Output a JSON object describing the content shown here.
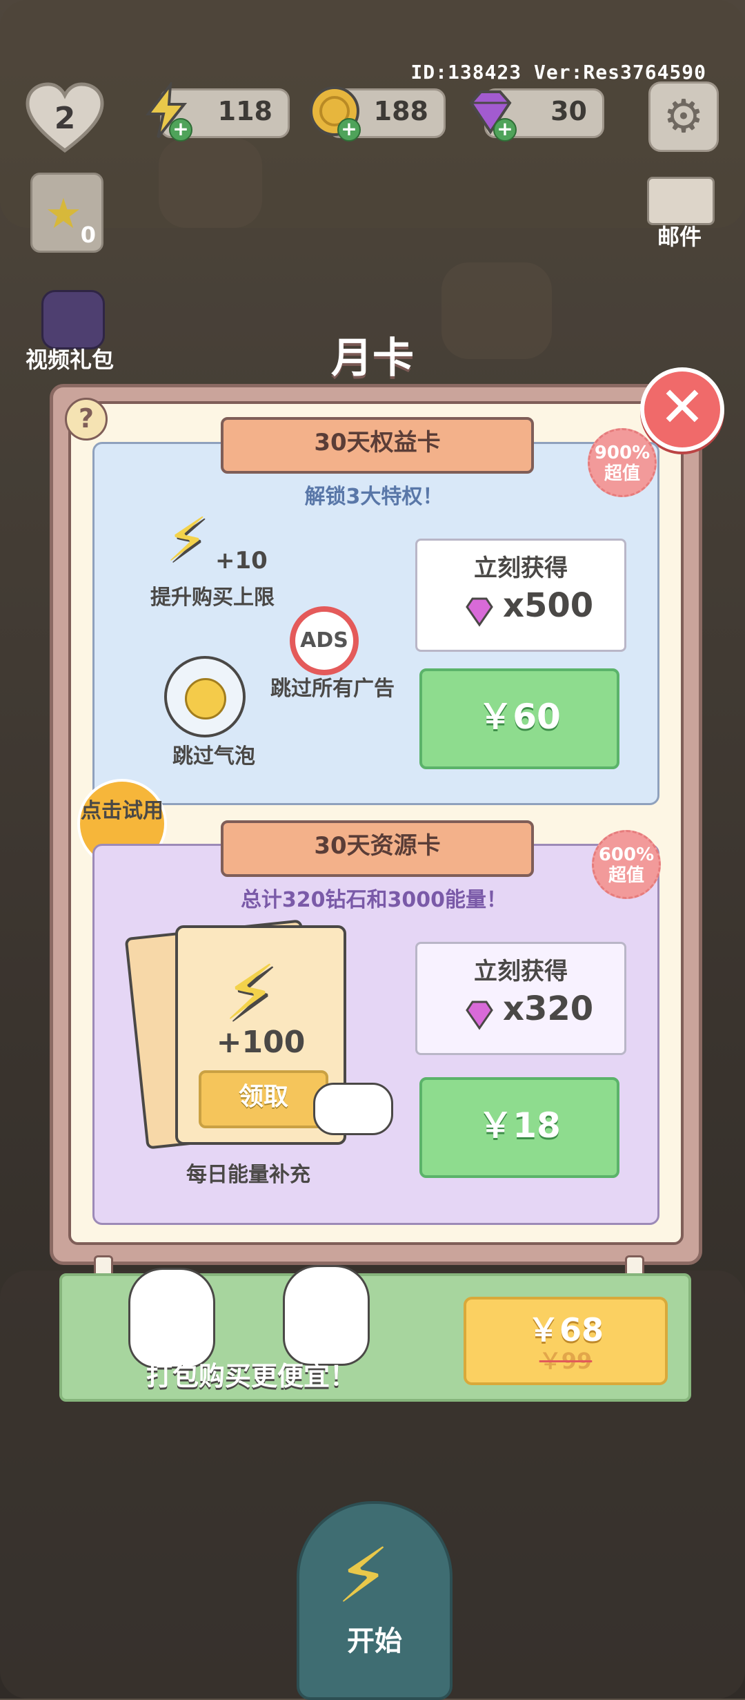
{
  "hud": {
    "id_version": "ID:138423 Ver:Res3764590",
    "lives": "2",
    "energy": "118",
    "coins": "188",
    "gems": "30",
    "star_jar_count": "0",
    "mail_label": "邮件",
    "video_gift_label": "视频礼包"
  },
  "dialog": {
    "title": "月卡",
    "help_icon": "question-icon",
    "close_icon": "close-icon"
  },
  "card1": {
    "ribbon": "30天权益卡",
    "subtitle": "解锁3大特权！",
    "badge_pct": "900%",
    "badge_txt": "超值",
    "perk1_plus": "+10",
    "perk1_label": "提升购买上限",
    "perk2_icon_text": "ADS",
    "perk2_label": "跳过所有广告",
    "perk3_label": "跳过气泡",
    "instant_title": "立刻获得",
    "instant_qty": "x500",
    "price": "￥60"
  },
  "try_badge": "点击试用",
  "card2": {
    "ribbon": "30天资源卡",
    "subtitle": "总计320钻石和3000能量！",
    "badge_pct": "600%",
    "badge_txt": "超值",
    "daily_amount": "+100",
    "claim_label": "领取",
    "daily_label": "每日能量补充",
    "instant_title": "立刻获得",
    "instant_qty": "x320",
    "price": "￥18"
  },
  "bundle": {
    "text": "打包购买更便宜！",
    "price_now": "￥68",
    "price_old": "￥99"
  },
  "start_button": {
    "label": "开始"
  },
  "colors": {
    "green_button": "#8edc8e",
    "close_red": "#f06a6a",
    "ribbon_orange": "#f3b18a"
  }
}
